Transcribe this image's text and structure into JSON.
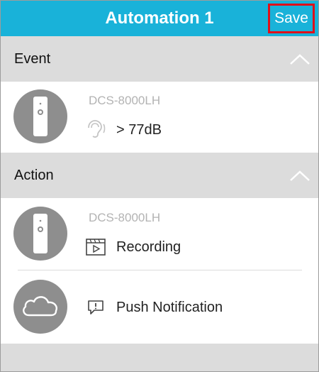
{
  "header": {
    "title": "Automation 1",
    "save_label": "Save"
  },
  "event": {
    "section_label": "Event",
    "device_name": "DCS-8000LH",
    "trigger_icon": "ear-icon",
    "trigger_text": "> 77dB"
  },
  "action": {
    "section_label": "Action",
    "items": [
      {
        "device_name": "DCS-8000LH",
        "icon": "video-clip-icon",
        "text": "Recording"
      },
      {
        "icon": "notification-icon",
        "text": "Push Notification"
      }
    ]
  },
  "colors": {
    "header_bg": "#19b2d9",
    "section_bg": "#dcdcdc",
    "avatar_bg": "#8e8e8e",
    "highlight_border": "#e0101a"
  }
}
